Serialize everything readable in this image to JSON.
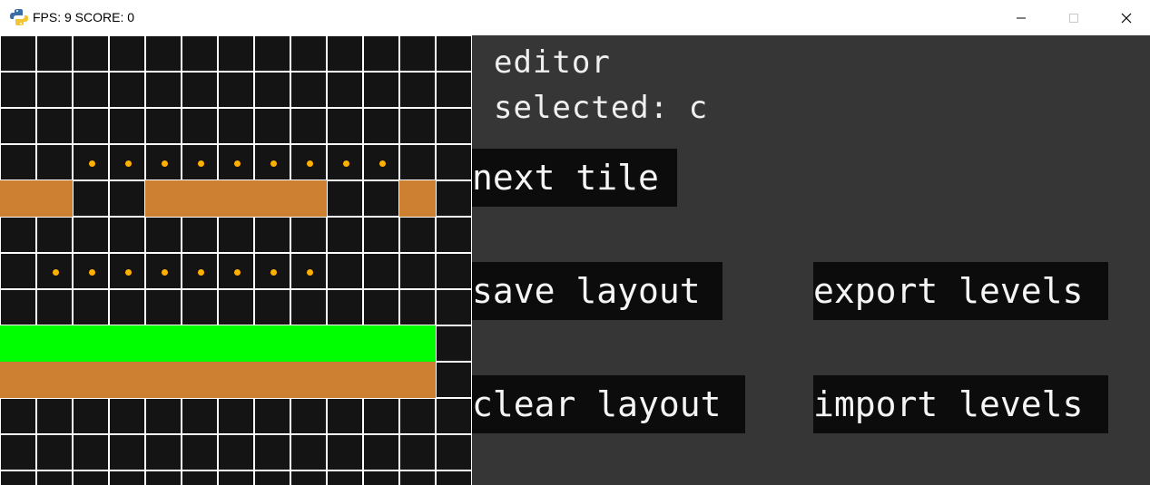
{
  "window": {
    "title": "FPS: 9 SCORE: 0",
    "icon": "python-icon",
    "controls": [
      "minimize-icon",
      "maximize-icon",
      "close-icon"
    ]
  },
  "editor": {
    "heading": "editor",
    "selected_label": "selected: c",
    "buttons": {
      "next_tile": "next tile",
      "save_layout": "save layout",
      "export_levels": "export levels",
      "clear_layout": "clear layout",
      "import_levels": "import levels"
    }
  },
  "level": {
    "legend": {
      ".": "empty",
      "c": "coin",
      "D": "dirt",
      "G": "grass"
    },
    "rows": [
      ".............",
      ".............",
      ".............",
      "..ccccccccc..",
      "DD..DDDDD..D.",
      ".............",
      ".cccccccc....",
      ".............",
      "GGGGGGGGGGGG.",
      "DDDDDDDDDDDD.",
      ".............",
      ".............",
      "............."
    ]
  },
  "colors": {
    "grid_bg": "#141414",
    "grid_line": "#ffffff",
    "dirt": "#cd7f32",
    "grass": "#00ff00",
    "coin": "#ffb000",
    "panel_bg": "#363636",
    "button_bg": "#0c0c0c"
  }
}
